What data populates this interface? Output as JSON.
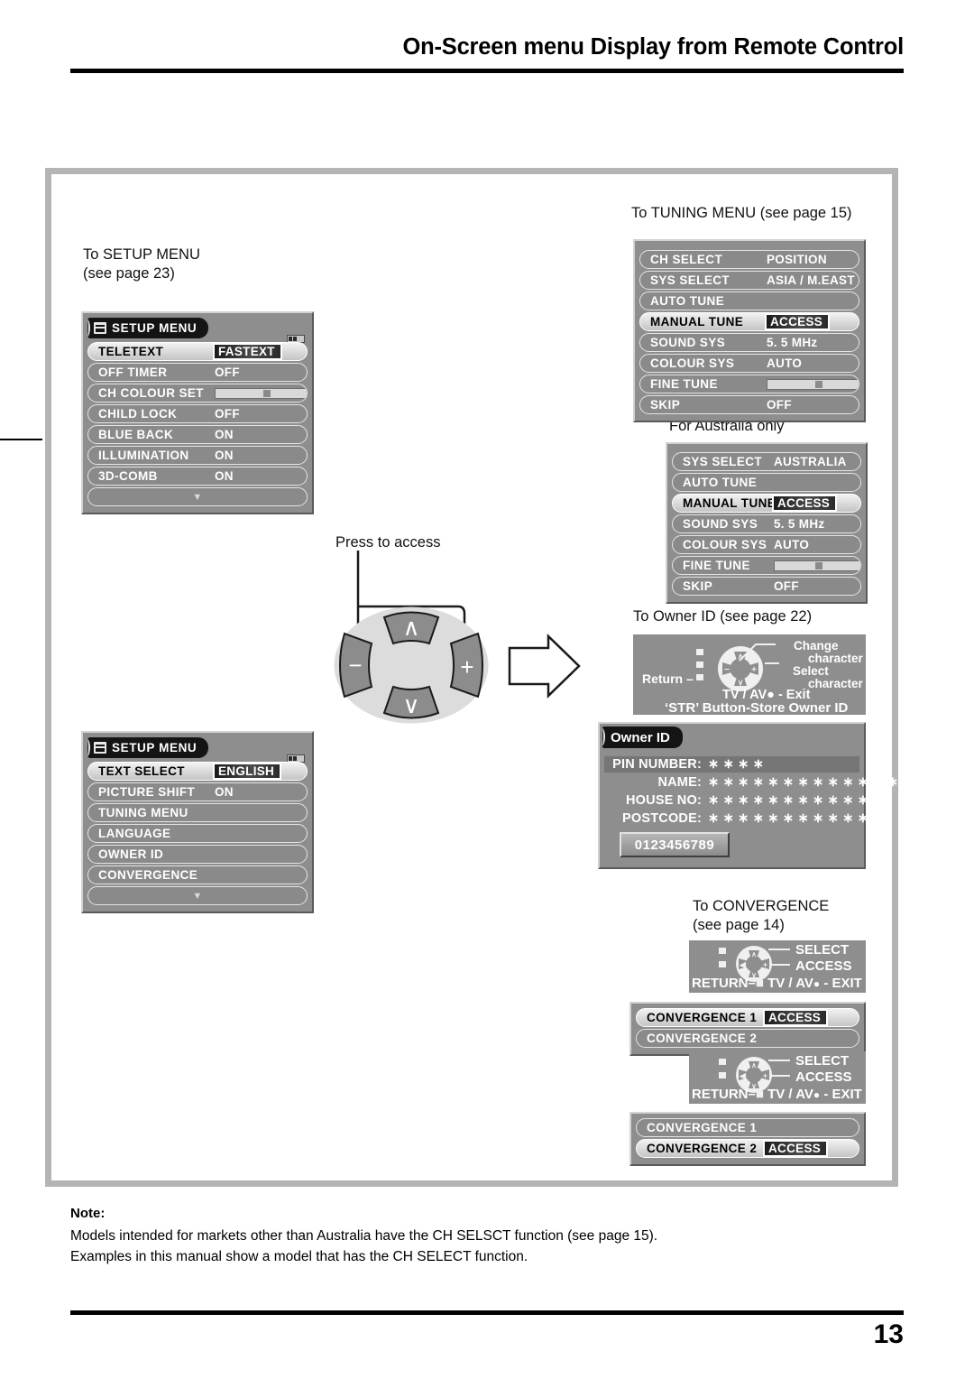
{
  "header": {
    "title": "On-Screen menu Display from Remote Control"
  },
  "captions": {
    "setup_menu": "To SETUP MENU",
    "setup_menu_page": "(see page 23)",
    "tuning_menu": "To TUNING MENU (see page 15)",
    "australia_only": "For Australia only",
    "owner_id": "To Owner ID (see page 22)",
    "convergence": "To CONVERGENCE",
    "convergence_page": "(see page 14)",
    "press_to_access": "Press to access"
  },
  "setup_menu_1": {
    "title": "SETUP MENU",
    "icon": "list-icon",
    "rows": [
      {
        "name": "TELETEXT",
        "value": "FASTEXT",
        "selected": true,
        "type": "value"
      },
      {
        "name": "OFF TIMER",
        "value": "OFF",
        "selected": false,
        "type": "value"
      },
      {
        "name": "CH  COLOUR  SET",
        "value": "",
        "selected": false,
        "type": "slider"
      },
      {
        "name": "CHILD LOCK",
        "value": "OFF",
        "selected": false,
        "type": "value"
      },
      {
        "name": "BLUE BACK",
        "value": "ON",
        "selected": false,
        "type": "value"
      },
      {
        "name": "ILLUMINATION",
        "value": "ON",
        "selected": false,
        "type": "value"
      },
      {
        "name": "3D-COMB",
        "value": "ON",
        "selected": false,
        "type": "value"
      },
      {
        "name": "▼",
        "value": "",
        "selected": false,
        "type": "arrow"
      }
    ]
  },
  "setup_menu_2": {
    "title": "SETUP MENU",
    "icon": "list-icon",
    "rows": [
      {
        "name": "TEXT  SELECT",
        "value": "ENGLISH",
        "selected": true,
        "type": "value"
      },
      {
        "name": "PICTURE SHIFT",
        "value": "ON",
        "selected": false,
        "type": "value"
      },
      {
        "name": "TUNING MENU",
        "value": "",
        "selected": false,
        "type": "value"
      },
      {
        "name": "LANGUAGE",
        "value": "",
        "selected": false,
        "type": "value"
      },
      {
        "name": "OWNER ID",
        "value": "",
        "selected": false,
        "type": "value"
      },
      {
        "name": "CONVERGENCE",
        "value": "",
        "selected": false,
        "type": "value"
      },
      {
        "name": "▼",
        "value": "",
        "selected": false,
        "type": "arrow"
      }
    ]
  },
  "tuning_menu": {
    "rows": [
      {
        "name": "CH  SELECT",
        "value": "POSITION",
        "selected": false,
        "type": "value"
      },
      {
        "name": "SYS SELECT",
        "value": "ASIA / M.EAST",
        "selected": false,
        "type": "value"
      },
      {
        "name": "AUTO  TUNE",
        "value": "",
        "selected": false,
        "type": "value"
      },
      {
        "name": "MANUAL  TUNE",
        "value": "ACCESS",
        "selected": true,
        "type": "value"
      },
      {
        "name": "SOUND  SYS",
        "value": "5. 5 MHz",
        "selected": false,
        "type": "value"
      },
      {
        "name": "COLOUR  SYS",
        "value": "AUTO",
        "selected": false,
        "type": "value"
      },
      {
        "name": "FINE  TUNE",
        "value": "",
        "selected": false,
        "type": "slider"
      },
      {
        "name": "SKIP",
        "value": "OFF",
        "selected": false,
        "type": "value"
      }
    ]
  },
  "australia_menu": {
    "rows": [
      {
        "name": "SYS SELECT",
        "value": "AUSTRALIA",
        "selected": false,
        "type": "value"
      },
      {
        "name": "AUTO  TUNE",
        "value": "",
        "selected": false,
        "type": "value"
      },
      {
        "name": "MANUAL  TUNE",
        "value": "ACCESS",
        "selected": true,
        "type": "value"
      },
      {
        "name": "SOUND  SYS",
        "value": "5. 5 MHz",
        "selected": false,
        "type": "value"
      },
      {
        "name": "COLOUR  SYS",
        "value": "AUTO",
        "selected": false,
        "type": "value"
      },
      {
        "name": "FINE  TUNE",
        "value": "",
        "selected": false,
        "type": "slider"
      },
      {
        "name": "SKIP",
        "value": "OFF",
        "selected": false,
        "type": "value"
      }
    ]
  },
  "owner_id_hint": {
    "change": "Change",
    "change2": "character",
    "select": "Select",
    "select2": "character",
    "return": "Return",
    "exit": "TV / AV",
    "exit2": "- Exit",
    "store": "‘STR’ Button-Store Owner ID"
  },
  "owner_id_panel": {
    "title": "Owner ID",
    "fields": [
      {
        "label": "PIN NUMBER:",
        "value": "∗ ∗ ∗ ∗"
      },
      {
        "label": "NAME:",
        "value": "∗ ∗ ∗ ∗ ∗ ∗ ∗ ∗ ∗ ∗ ∗ ∗ ∗"
      },
      {
        "label": "HOUSE NO:",
        "value": "∗ ∗ ∗ ∗ ∗ ∗ ∗ ∗ ∗ ∗ ∗"
      },
      {
        "label": "POSTCODE:",
        "value": "∗ ∗ ∗ ∗ ∗ ∗ ∗ ∗ ∗ ∗ ∗"
      }
    ],
    "digits": "0123456789"
  },
  "convergence_hint": {
    "select": "SELECT",
    "access": "ACCESS",
    "return": "RETURN",
    "tvav": "TV / AV",
    "exit": "- EXIT"
  },
  "convergence_1": {
    "rows": [
      {
        "name": "CONVERGENCE  1",
        "value": "ACCESS",
        "selected": true,
        "type": "value"
      },
      {
        "name": "CONVERGENCE  2",
        "value": "",
        "selected": false,
        "type": "value"
      }
    ]
  },
  "convergence_2": {
    "rows": [
      {
        "name": "CONVERGENCE  1",
        "value": "",
        "selected": false,
        "type": "value"
      },
      {
        "name": "CONVERGENCE  2",
        "value": "ACCESS",
        "selected": true,
        "type": "value"
      }
    ]
  },
  "keypad": {
    "up": "∧",
    "down": "∨",
    "left": "−",
    "right": "+"
  },
  "note": {
    "label": "Note:",
    "line1": "Models intended for markets other than Australia have the CH SELSCT function (see page 15).",
    "line2": "Examples in this manual show a model that has the CH SELECT function."
  },
  "footer": {
    "page": "13"
  },
  "colors": {
    "osd_bg": "#8e8e8e",
    "row_bg": "#8a8a8a",
    "selected_text": "#000000",
    "value_box": "#1a1a1a",
    "frame": "#b4b4b4"
  }
}
